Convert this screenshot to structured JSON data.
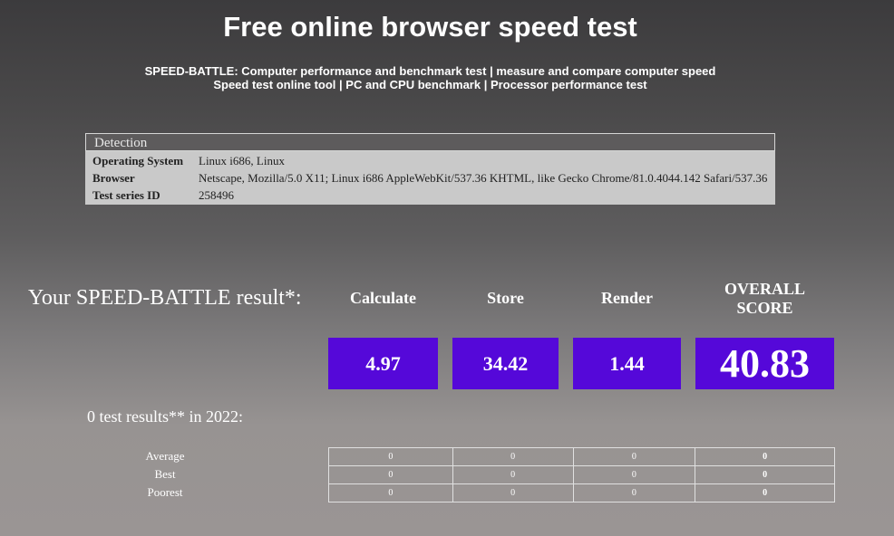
{
  "header": {
    "title": "Free online browser speed test",
    "subtitle_line1": "SPEED-BATTLE: Computer performance and benchmark test | measure and compare computer speed",
    "subtitle_line2": "Speed test online tool | PC and CPU benchmark | Processor performance test"
  },
  "detection": {
    "heading": "Detection",
    "rows": [
      {
        "label": "Operating System",
        "value": "Linux i686, Linux"
      },
      {
        "label": "Browser",
        "value": "Netscape, Mozilla/5.0 X11; Linux i686 AppleWebKit/537.36 KHTML, like Gecko Chrome/81.0.4044.142 Safari/537.36"
      },
      {
        "label": "Test series ID",
        "value": "258496"
      }
    ]
  },
  "result": {
    "title": "Your SPEED-BATTLE result*:",
    "columns": {
      "calculate": "Calculate",
      "store": "Store",
      "render": "Render",
      "overall_line1": "OVERALL",
      "overall_line2": "SCORE"
    },
    "scores": {
      "calculate": "4.97",
      "store": "34.42",
      "render": "1.44",
      "overall": "40.83"
    },
    "accent_color": "#5508d9"
  },
  "tests": {
    "title": "0 test results** in 2022:",
    "rows": [
      {
        "label": "Average",
        "values": [
          "0",
          "0",
          "0",
          "0"
        ]
      },
      {
        "label": "Best",
        "values": [
          "0",
          "0",
          "0",
          "0"
        ]
      },
      {
        "label": "Poorest",
        "values": [
          "0",
          "0",
          "0",
          "0"
        ]
      }
    ]
  }
}
